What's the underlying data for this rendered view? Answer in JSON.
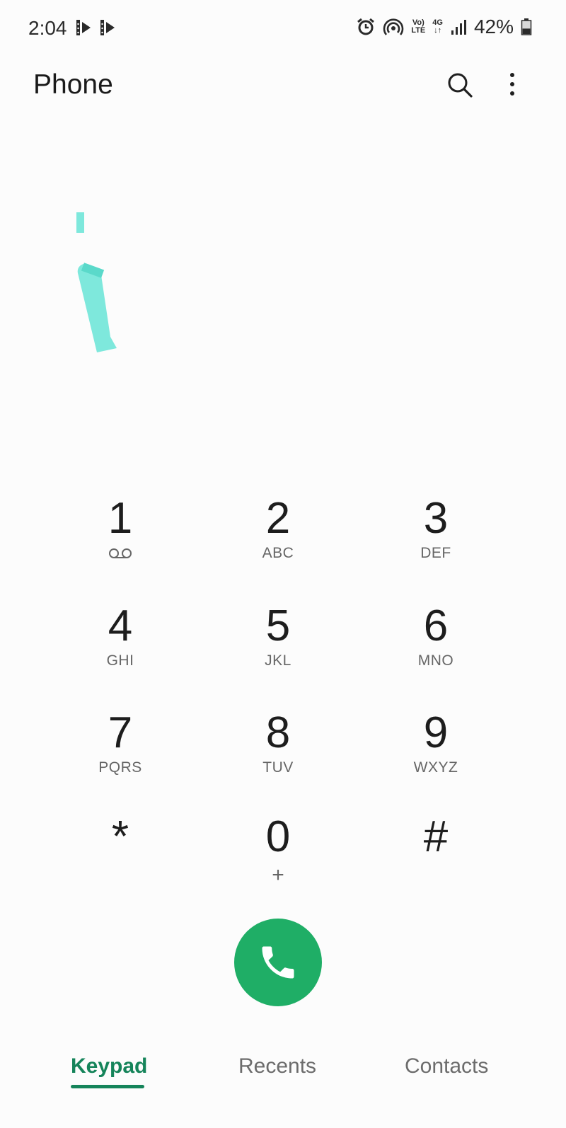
{
  "status_bar": {
    "time": "2:04",
    "volte_line1": "Vo)",
    "volte_line2": "LTE",
    "network_type": "4G",
    "battery_percent": "42%",
    "battery_level": 0.42,
    "left_icons": [
      "notification-icon",
      "notification-icon"
    ],
    "right_icons": [
      "alarm-icon",
      "hotspot-icon",
      "volte-icon",
      "4g-data-icon",
      "signal-icon",
      "battery-icon"
    ]
  },
  "app_bar": {
    "title": "Phone",
    "actions": [
      "search-icon",
      "more-options-icon"
    ]
  },
  "dial_input": {
    "value": ""
  },
  "keypad": [
    {
      "digit": "1",
      "letters": "",
      "icon": "voicemail-icon"
    },
    {
      "digit": "2",
      "letters": "ABC"
    },
    {
      "digit": "3",
      "letters": "DEF"
    },
    {
      "digit": "4",
      "letters": "GHI"
    },
    {
      "digit": "5",
      "letters": "JKL"
    },
    {
      "digit": "6",
      "letters": "MNO"
    },
    {
      "digit": "7",
      "letters": "PQRS"
    },
    {
      "digit": "8",
      "letters": "TUV"
    },
    {
      "digit": "9",
      "letters": "WXYZ"
    },
    {
      "digit": "*",
      "letters": ""
    },
    {
      "digit": "0",
      "letters": "+"
    },
    {
      "digit": "#",
      "letters": ""
    }
  ],
  "call_button": {
    "icon": "phone-icon",
    "color": "#1fae66"
  },
  "tabs": [
    {
      "label": "Keypad",
      "active": true
    },
    {
      "label": "Recents",
      "active": false
    },
    {
      "label": "Contacts",
      "active": false
    }
  ],
  "colors": {
    "accent": "#15845a",
    "call_green": "#1fae66",
    "cursor_teal": "#7ee8dc"
  }
}
